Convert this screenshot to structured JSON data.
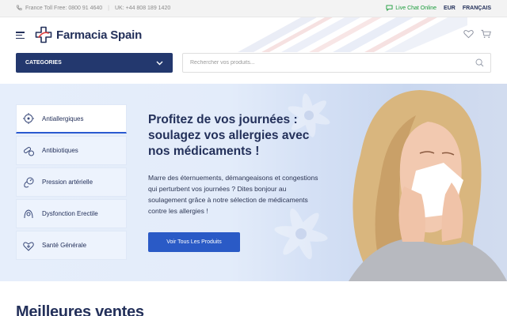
{
  "topbar": {
    "phone_fr": "France Toll Free: 0800 91 4640",
    "separator": "|",
    "phone_uk": "UK: +44 808 189 1420",
    "live_chat": "Live Chat Online",
    "currency": "EUR",
    "language": "FRANÇAIS"
  },
  "header": {
    "logo_text": "Farmacia Spain"
  },
  "categories_button": "CATEGORIES",
  "search": {
    "placeholder": "Rechercher vos produits..."
  },
  "sidebar": {
    "items": [
      {
        "label": "Antiallergiques",
        "icon": "allergy-icon"
      },
      {
        "label": "Antibiotiques",
        "icon": "pills-icon"
      },
      {
        "label": "Pression artérielle",
        "icon": "blood-pressure-icon"
      },
      {
        "label": "Dysfonction Erectile",
        "icon": "ed-icon"
      },
      {
        "label": "Santé Générale",
        "icon": "health-icon"
      }
    ]
  },
  "hero": {
    "title": "Profitez de vos journées : soulagez vos allergies avec nos médicaments !",
    "body": "Marre des éternuements, démangeaisons et congestions qui perturbent vos journées ? Dites bonjour au soulagement grâce à notre sélection de médicaments contre les allergies !",
    "cta": "Voir Tous Les Produits"
  },
  "bestsellers_title": "Meilleures ventes",
  "colors": {
    "navy": "#23305a",
    "button_blue": "#2a5ac6",
    "category_bg": "#23386e",
    "live_green": "#1a9b3a"
  }
}
